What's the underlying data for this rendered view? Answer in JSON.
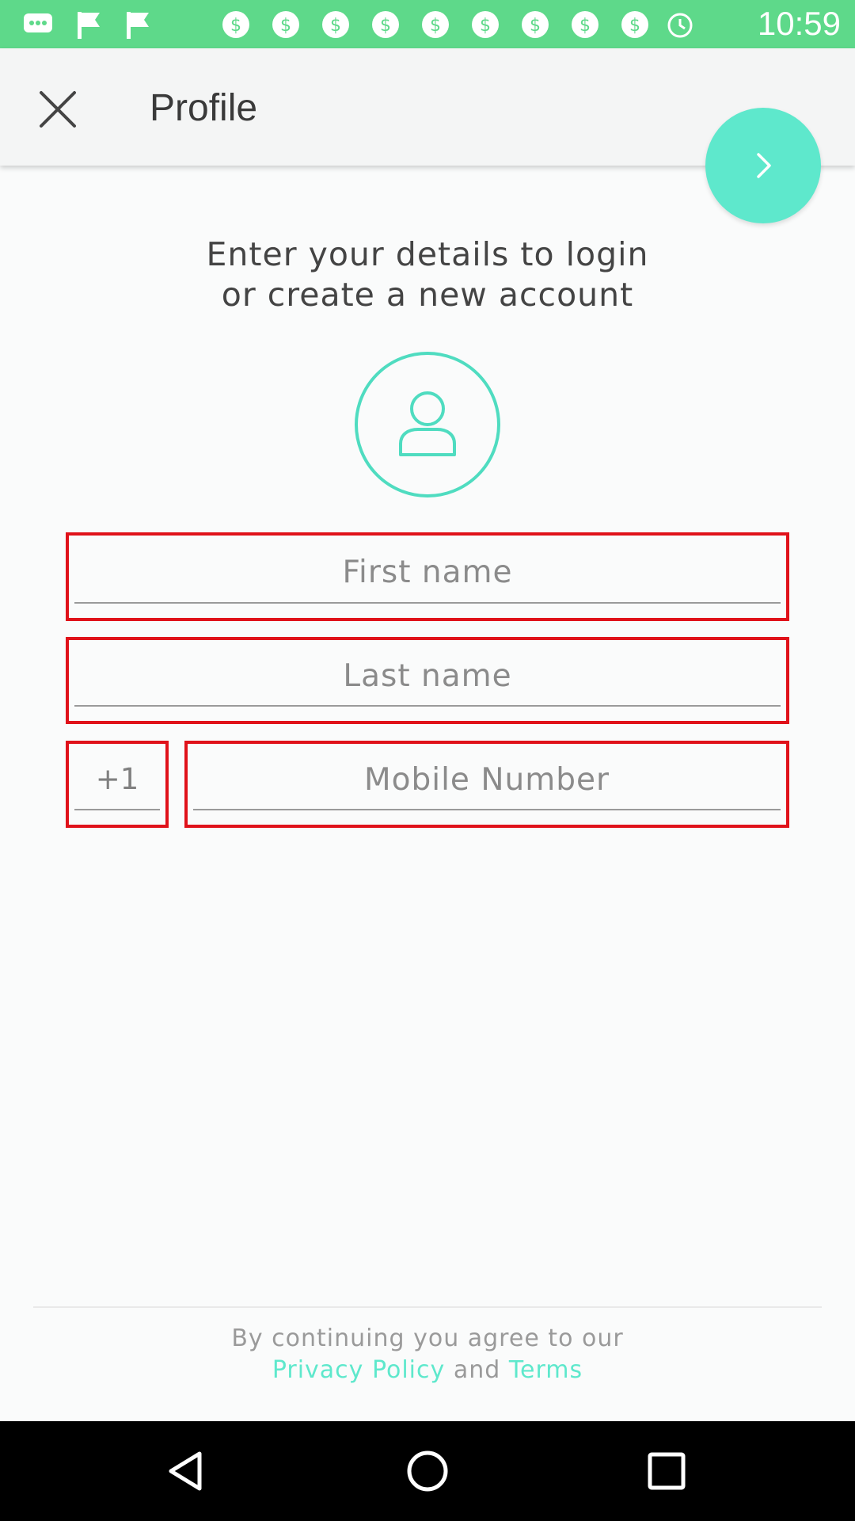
{
  "status_bar": {
    "time": "10:59",
    "notification_icons": [
      "chat-bubble-icon",
      "flag-icon",
      "flag-icon",
      "dollar-circle-icon",
      "dollar-circle-icon",
      "dollar-circle-icon",
      "dollar-circle-icon",
      "dollar-circle-icon",
      "dollar-circle-icon",
      "dollar-circle-icon",
      "dollar-circle-icon"
    ]
  },
  "header": {
    "title": "Profile",
    "close_icon": "close-icon",
    "next_icon": "chevron-right-icon"
  },
  "intro": {
    "line1": "Enter your details to login",
    "line2": "or create a new account"
  },
  "avatar": {
    "icon": "user-icon"
  },
  "form": {
    "first_name_placeholder": "First name",
    "last_name_placeholder": "Last name",
    "country_code": "+1",
    "mobile_placeholder": "Mobile Number"
  },
  "legal": {
    "text": "By continuing you agree to our",
    "privacy_link": "Privacy Policy",
    "and": "and",
    "terms_link": "Terms"
  },
  "colors": {
    "status_bar": "#5ed98a",
    "accent": "#5ee8cc",
    "error_border": "#e0121a",
    "nav_bar": "#000000"
  },
  "nav": [
    "back-icon",
    "home-icon",
    "recents-icon"
  ]
}
